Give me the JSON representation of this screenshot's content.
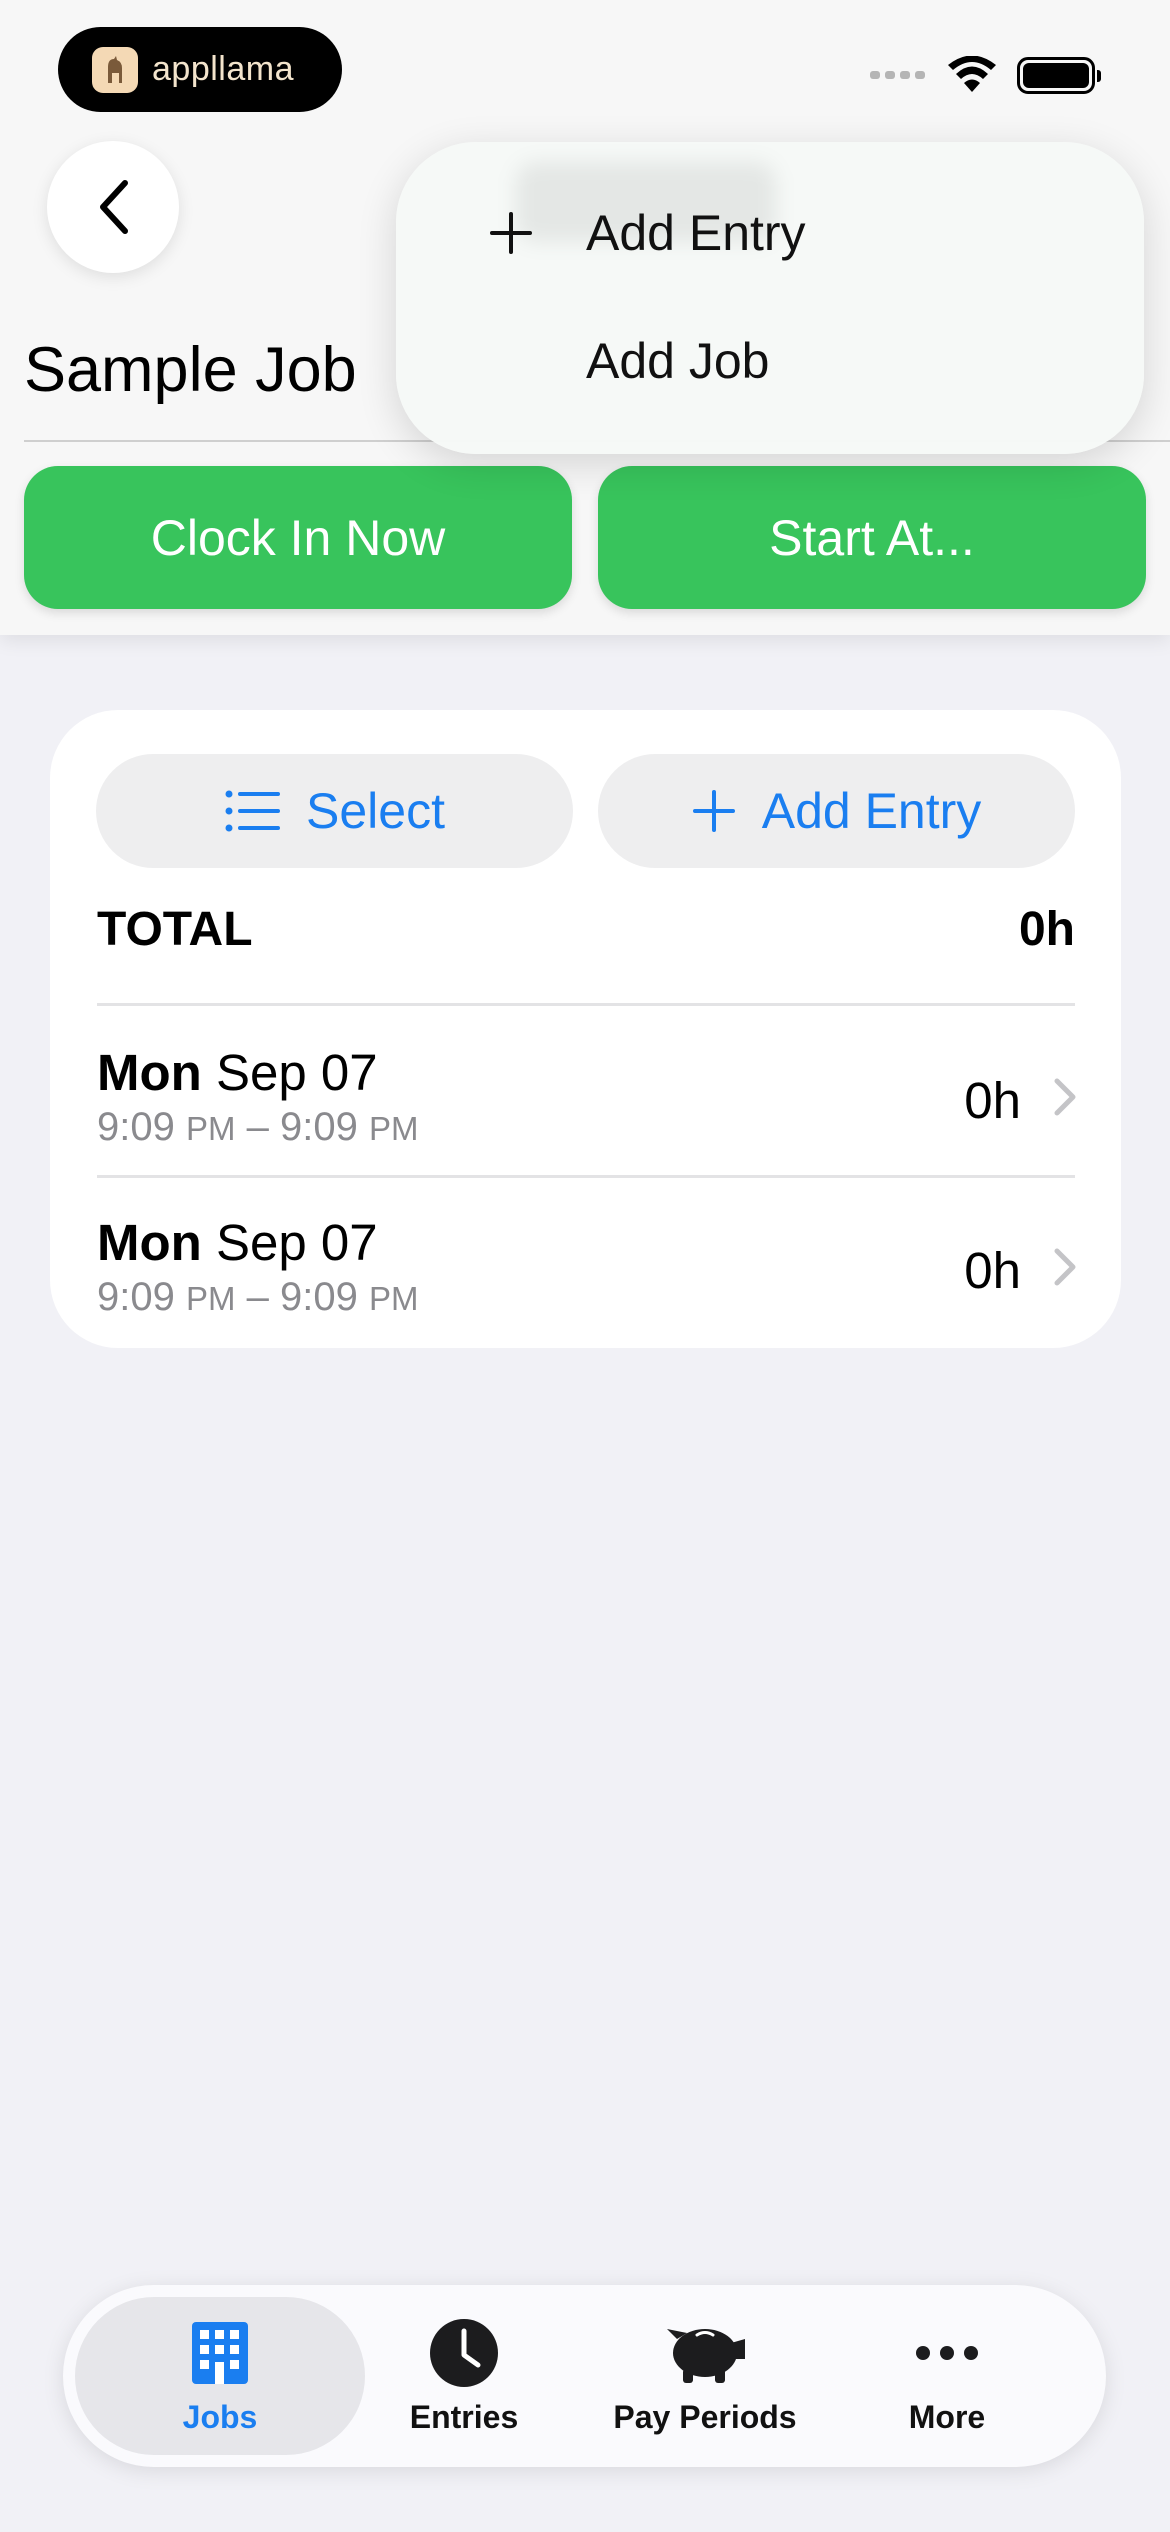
{
  "status_bar": {
    "brand": "appllama"
  },
  "header": {
    "title": "Sample Job",
    "clock_in_label": "Clock In Now",
    "start_at_label": "Start At..."
  },
  "menu": {
    "add_entry_label": "Add Entry",
    "add_job_label": "Add Job"
  },
  "card": {
    "select_label": "Select",
    "add_entry_label": "Add Entry",
    "total_label": "TOTAL",
    "total_value": "0h",
    "entries": [
      {
        "day": "Mon",
        "date": "Sep 07",
        "start": "9:09",
        "start_ampm": "PM",
        "end": "9:09",
        "end_ampm": "PM",
        "hours": "0h"
      },
      {
        "day": "Mon",
        "date": "Sep 07",
        "start": "9:09",
        "start_ampm": "PM",
        "end": "9:09",
        "end_ampm": "PM",
        "hours": "0h"
      }
    ]
  },
  "tabbar": {
    "tabs": [
      {
        "label": "Jobs",
        "icon": "building-icon",
        "active": true
      },
      {
        "label": "Entries",
        "icon": "clock-icon",
        "active": false
      },
      {
        "label": "Pay Periods",
        "icon": "piggy-bank-icon",
        "active": false
      },
      {
        "label": "More",
        "icon": "ellipsis-icon",
        "active": false
      }
    ]
  },
  "colors": {
    "accent": "#1a7ef0",
    "green": "#38c45c",
    "background": "#f1f1f6"
  }
}
